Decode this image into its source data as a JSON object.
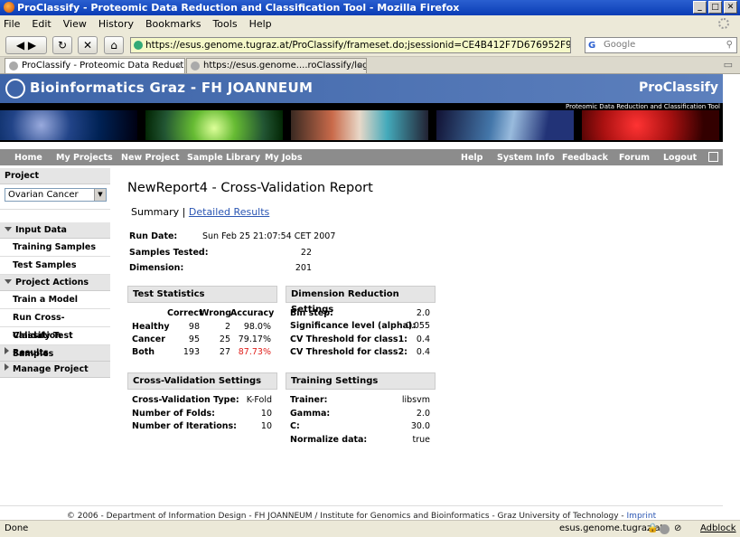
{
  "window": {
    "title": "ProClassify - Proteomic Data Reduction and Classification Tool - Mozilla Firefox"
  },
  "menu": [
    "File",
    "Edit",
    "View",
    "History",
    "Bookmarks",
    "Tools",
    "Help"
  ],
  "browser": {
    "url": "https://esus.genome.tugraz.at/ProClassify/frameset.do;jsessionid=CE4B412F7D676952F9C7AC0F1A7B5825",
    "search_placeholder": "Google",
    "tabs": [
      {
        "label": "ProClassify - Proteomic Data Reduction a..."
      },
      {
        "label": "https://esus.genome....roClassify/login.do"
      }
    ],
    "status": "Done",
    "status_host": "esus.genome.tugraz.at",
    "adblock": "Adblock"
  },
  "header": {
    "org": "Bioinformatics Graz - FH JOANNEUM",
    "product": "ProClassify",
    "subtitle": "Proteomic Data Reduction and Classification Tool"
  },
  "nav": {
    "left": [
      "Home",
      "My Projects",
      "New Project",
      "Sample Library",
      "My Jobs"
    ],
    "right": [
      "Help",
      "System Info",
      "Feedback",
      "Forum",
      "Logout"
    ]
  },
  "sidebar": {
    "project_label": "Project",
    "project_value": "Ovarian Cancer",
    "input_data": "Input Data",
    "training_samples": "Training Samples",
    "test_samples": "Test Samples",
    "project_actions": "Project Actions",
    "train_model": "Train a Model",
    "run_cv": "Run Cross-Validation",
    "classify": "Classify Test Samples",
    "results": "Results",
    "manage": "Manage Project"
  },
  "report": {
    "title": "NewReport4 - Cross-Validation Report",
    "summary": "Summary",
    "sep": "|",
    "detailed": "Detailed Results",
    "run_date_label": "Run Date:",
    "run_date": "Sun Feb 25 21:07:54 CET 2007",
    "samples_label": "Samples Tested:",
    "samples": "22",
    "dimension_label": "Dimension:",
    "dimension": "201"
  },
  "test_stats": {
    "title": "Test Statistics",
    "headers": [
      "Correct",
      "Wrong",
      "Accuracy"
    ],
    "rows": [
      {
        "label": "Healthy",
        "correct": "98",
        "wrong": "2",
        "accuracy": "98.0%"
      },
      {
        "label": "Cancer",
        "correct": "95",
        "wrong": "25",
        "accuracy": "79.17%"
      },
      {
        "label": "Both",
        "correct": "193",
        "wrong": "27",
        "accuracy": "87.73%"
      }
    ],
    "highlight_color": "#e0201c"
  },
  "dim_red": {
    "title": "Dimension Reduction Settings",
    "rows": [
      {
        "label": "Bin step:",
        "value": "2.0"
      },
      {
        "label": "Significance level (alpha):",
        "value": "0.055"
      },
      {
        "label": "CV Threshold for class1:",
        "value": "0.4"
      },
      {
        "label": "CV Threshold for class2:",
        "value": "0.4"
      }
    ]
  },
  "cv_settings": {
    "title": "Cross-Validation Settings",
    "rows": [
      {
        "label": "Cross-Validation Type:",
        "value": "K-Fold"
      },
      {
        "label": "Number of Folds:",
        "value": "10"
      },
      {
        "label": "Number of Iterations:",
        "value": "10"
      }
    ]
  },
  "training": {
    "title": "Training Settings",
    "rows": [
      {
        "label": "Trainer:",
        "value": "libsvm"
      },
      {
        "label": "Gamma:",
        "value": "2.0"
      },
      {
        "label": "C:",
        "value": "30.0"
      },
      {
        "label": "Normalize data:",
        "value": "true"
      }
    ]
  },
  "footer": {
    "text": "© 2006 - Department of Information Design - FH JOANNEUM  /  Institute for Genomics and Bioinformatics - Graz University of Technology -",
    "imprint": "Imprint"
  }
}
